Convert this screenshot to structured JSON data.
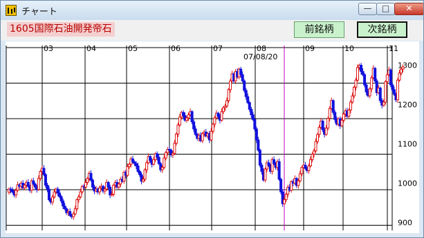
{
  "window": {
    "title": "チャート",
    "minimize_label": "—",
    "maximize_label": "□",
    "close_label": "✕"
  },
  "toolbar": {
    "stock_name": "1605国際石油開発帝石",
    "prev_label": "前銘柄",
    "next_label": "次銘柄"
  },
  "colors": {
    "up": "#dd1111",
    "down": "#1111dd",
    "cursor": "#c000c0",
    "grid": "#000000"
  },
  "chart_data": {
    "type": "candlestick",
    "months": [
      "03",
      "04",
      "05",
      "06",
      "07",
      "08",
      "09",
      "10",
      "11"
    ],
    "cursor_label": "07/08/20",
    "y_ticks": [
      900,
      1000,
      1100,
      1200,
      1300
    ],
    "ylim": [
      880,
      1350
    ],
    "closes": [
      985,
      982,
      978,
      970,
      982,
      996,
      992,
      1000,
      988,
      995,
      1002,
      992,
      982,
      1006,
      998,
      990,
      984,
      1012,
      1030,
      1038,
      1022,
      995,
      985,
      958,
      952,
      965,
      978,
      985,
      975,
      966,
      955,
      942,
      935,
      925,
      928,
      918,
      915,
      922,
      935,
      958,
      965,
      978,
      992,
      990,
      1002,
      1012,
      1025,
      1008,
      990,
      980,
      985,
      978,
      988,
      992,
      980,
      985,
      1002,
      990,
      970,
      972,
      995,
      1002,
      990,
      998,
      1010,
      1005,
      1028,
      1020,
      1042,
      1048,
      1062,
      1054,
      1050,
      1044,
      1030,
      1022,
      1005,
      1010,
      1034,
      1052,
      1068,
      1058,
      1048,
      1060,
      1075,
      1066,
      1050,
      1034,
      1040,
      1064,
      1078,
      1086,
      1084,
      1072,
      1076,
      1102,
      1125,
      1148,
      1168,
      1180,
      1172,
      1160,
      1166,
      1174,
      1182,
      1156,
      1138,
      1124,
      1114,
      1122,
      1108,
      1126,
      1130,
      1120,
      1126,
      1110,
      1132,
      1150,
      1166,
      1178,
      1170,
      1160,
      1182,
      1192,
      1196,
      1210,
      1238,
      1260,
      1278,
      1260,
      1284,
      1270,
      1290,
      1276,
      1260,
      1236,
      1220,
      1205,
      1188,
      1174,
      1162,
      1138,
      1110,
      1084,
      1046,
      1030,
      1008,
      1036,
      1052,
      1045,
      1030,
      1060,
      1050,
      1040,
      1055,
      1010,
      978,
      948,
      958,
      972,
      990,
      982,
      1004,
      1000,
      1012,
      994,
      1006,
      1024,
      1040,
      1046,
      1038,
      1032,
      1044,
      1060,
      1074,
      1082,
      1106,
      1124,
      1142,
      1158,
      1136,
      1124,
      1140,
      1165,
      1190,
      1210,
      1180,
      1162,
      1150,
      1164,
      1146,
      1160,
      1176,
      1184,
      1170,
      1186,
      1206,
      1222,
      1244,
      1262,
      1294,
      1300,
      1284,
      1276,
      1250,
      1232,
      1222,
      1240,
      1268,
      1292,
      1260,
      1230,
      1242,
      1210,
      1198,
      1206,
      1258,
      1276,
      1288,
      1250,
      1238,
      1226,
      1212,
      1262,
      1280,
      1290,
      1296
    ]
  }
}
